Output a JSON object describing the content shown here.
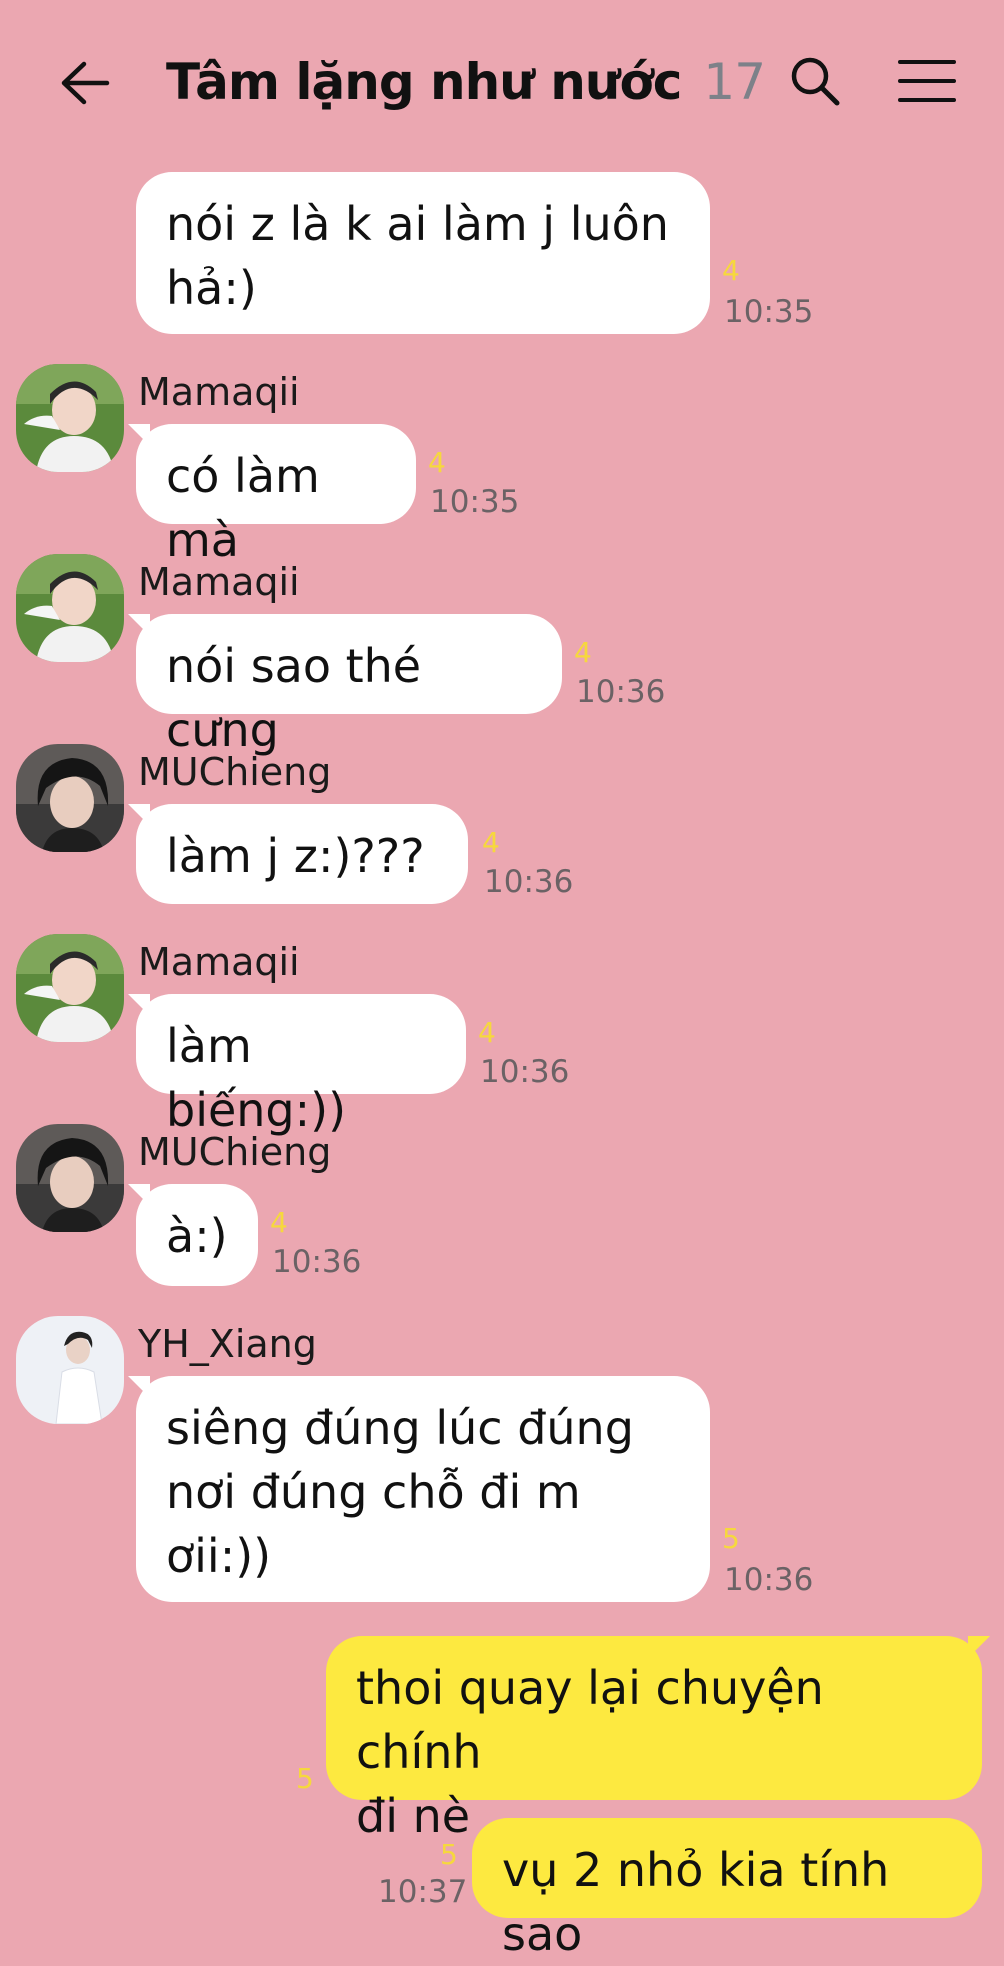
{
  "header": {
    "title": "Tâm lặng như nước",
    "member_count": "17",
    "back_icon": "arrow-left-icon",
    "search_icon": "search-icon",
    "menu_icon": "hamburger-menu-icon"
  },
  "colors": {
    "background": "#eba7b1",
    "bubble_other": "#ffffff",
    "bubble_mine": "#fde940",
    "unread_count": "#f6d83d"
  },
  "messages": [
    {
      "sender": "",
      "text": "nói z là k ai làm j luôn\nhả:)",
      "unread": "4",
      "time": "10:35"
    },
    {
      "sender": "Mamaqii",
      "text": "có làm mà",
      "unread": "4",
      "time": "10:35"
    },
    {
      "sender": "Mamaqii",
      "text": "nói sao thé cưng",
      "unread": "4",
      "time": "10:36"
    },
    {
      "sender": "MUChieng",
      "text": "làm j z:)???",
      "unread": "4",
      "time": "10:36"
    },
    {
      "sender": "Mamaqii",
      "text": "làm biếng:))",
      "unread": "4",
      "time": "10:36"
    },
    {
      "sender": "MUChieng",
      "text": "à:)",
      "unread": "4",
      "time": "10:36"
    },
    {
      "sender": "YH_Xiang",
      "text": "siêng đúng lúc đúng\nnơi đúng chỗ đi m\nơii:))",
      "unread": "5",
      "time": "10:36"
    },
    {
      "sender": "me",
      "text": "thoi quay lại chuyện chính\nđi nè",
      "unread": "5",
      "time": ""
    },
    {
      "sender": "me",
      "text": "vụ 2 nhỏ kia tính sao",
      "unread": "5",
      "time": "10:37"
    }
  ]
}
